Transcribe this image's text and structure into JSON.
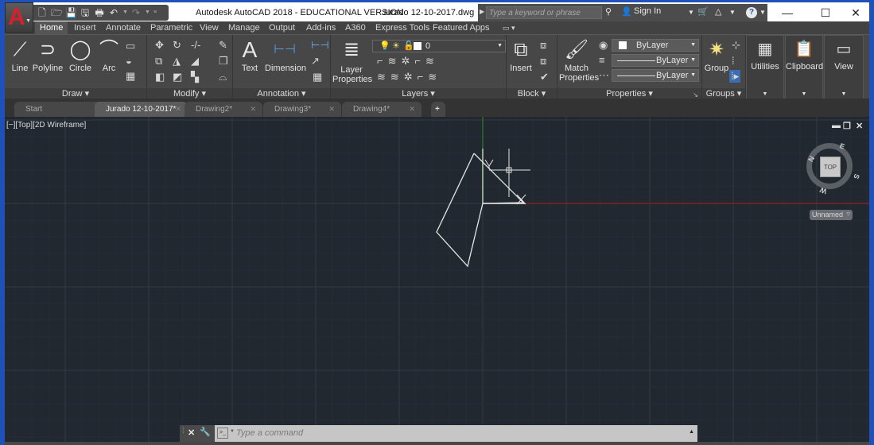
{
  "window": {
    "app_title": "Autodesk AutoCAD 2018 - EDUCATIONAL VERSION",
    "file_title": "Jurado 12-10-2017.dwg",
    "minimize": "—",
    "maximize": "☐",
    "close": "✕"
  },
  "app_button": {
    "label": "A",
    "icon": "autocad-logo-icon"
  },
  "quick_access": [
    {
      "name": "new-icon",
      "glyph": "🗋"
    },
    {
      "name": "open-icon",
      "glyph": "🗁"
    },
    {
      "name": "save-icon",
      "glyph": "💾"
    },
    {
      "name": "save-as-icon",
      "glyph": "🖫"
    },
    {
      "name": "print-icon",
      "glyph": "🖶"
    },
    {
      "name": "undo-icon",
      "glyph": "↶"
    },
    {
      "name": "redo-icon",
      "glyph": "↷"
    }
  ],
  "infocenter": {
    "search_placeholder": "Type a keyword or phrase",
    "sign_in": "Sign In",
    "binoculars": "⚲",
    "user": "👤",
    "cart": "🛒",
    "a360": "△",
    "help": "?"
  },
  "ribbon_tabs": [
    "Home",
    "Insert",
    "Annotate",
    "Parametric",
    "View",
    "Manage",
    "Output",
    "Add-ins",
    "A360",
    "Express Tools",
    "Featured Apps"
  ],
  "active_ribbon_tab": "Home",
  "panels": {
    "draw": {
      "title": "Draw ▾",
      "tools": [
        {
          "label": "Line",
          "glyph": "⟋"
        },
        {
          "label": "Polyline",
          "glyph": "⊃"
        },
        {
          "label": "Circle",
          "glyph": "◯"
        },
        {
          "label": "Arc",
          "glyph": "⌒"
        }
      ]
    },
    "modify": {
      "title": "Modify ▾"
    },
    "annotation": {
      "title": "Annotation ▾",
      "tools": [
        {
          "label": "Text",
          "glyph": "A"
        },
        {
          "label": "Dimension",
          "glyph": "⊢⊣"
        }
      ]
    },
    "layers": {
      "title": "Layers ▾",
      "layer_properties": "Layer\nProperties",
      "current_layer": "0"
    },
    "block": {
      "title": "Block ▾",
      "insert": "Insert"
    },
    "properties": {
      "title": "Properties ▾",
      "match": "Match\nProperties",
      "color": "ByLayer",
      "linetype": "ByLayer",
      "lineweight": "ByLayer"
    },
    "groups": {
      "title": "Groups ▾",
      "group": "Group"
    },
    "utilities": {
      "label": "Utilities"
    },
    "clipboard": {
      "label": "Clipboard"
    },
    "view": {
      "label": "View"
    }
  },
  "file_tabs": [
    {
      "label": "Start",
      "active": false,
      "closable": false
    },
    {
      "label": "Jurado 12-10-2017*",
      "active": true,
      "closable": true
    },
    {
      "label": "Drawing2*",
      "active": false,
      "closable": true
    },
    {
      "label": "Drawing3*",
      "active": false,
      "closable": true
    },
    {
      "label": "Drawing4*",
      "active": false,
      "closable": true
    }
  ],
  "new_tab": "+",
  "viewport": {
    "label": "[−][Top][2D Wireframe]",
    "viewcube": {
      "face": "TOP",
      "n": "N",
      "e": "E",
      "s": "S",
      "w": "W"
    },
    "ucs_menu": "Unnamed",
    "controls": {
      "min": "▬",
      "restore": "❐",
      "close": "✕"
    }
  },
  "command_line": {
    "placeholder": "Type a command",
    "close": "✕",
    "customize": "🔧",
    "prompt": ">_"
  },
  "colors": {
    "canvas_bg": "#212830",
    "x_axis": "#7a2424",
    "y_axis": "#2e6a2e",
    "geometry": "#e6e6e6",
    "window_frame": "#1f51b8"
  }
}
